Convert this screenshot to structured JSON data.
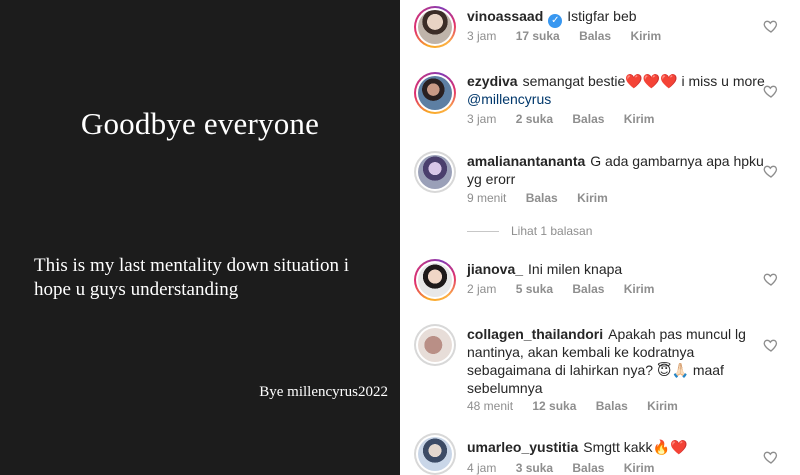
{
  "story": {
    "headline": "Goodbye everyone",
    "message": "This is my last mentality down situation i hope u guys understanding",
    "signoff": "Bye millencyrus2022"
  },
  "actions": {
    "reply": "Balas",
    "send": "Kirim"
  },
  "view_replies": "Lihat 1 balasan",
  "colors": {
    "story_bg": "#1c1c1c",
    "username": "#262626",
    "meta": "#8e8e8e",
    "mention": "#00376b",
    "verified": "#3897f0"
  },
  "comments": [
    {
      "username": "vinoassaad",
      "verified": true,
      "text": "Istigfar beb",
      "time": "3 jam",
      "likes": "17 suka",
      "reply": "Balas",
      "send": "Kirim",
      "avatar": "profile-photo"
    },
    {
      "username": "ezydiva",
      "verified": false,
      "text": "semangat bestie",
      "emoji": "❤️❤️❤️",
      "text2": " i miss u more ",
      "mention": "@millencyrus",
      "time": "3 jam",
      "likes": "2 suka",
      "reply": "Balas",
      "send": "Kirim",
      "avatar": "profile-photo"
    },
    {
      "username": "amalianantananta",
      "verified": false,
      "text": "G ada gambarnya apa hpku yg erorr",
      "time": "9 menit",
      "reply": "Balas",
      "send": "Kirim",
      "avatar": "profile-photo"
    },
    {
      "username": "jianova_",
      "verified": false,
      "text": "Ini milen knapa",
      "time": "2 jam",
      "likes": "5 suka",
      "reply": "Balas",
      "send": "Kirim",
      "avatar": "profile-photo"
    },
    {
      "username": "collagen_thailandori",
      "verified": false,
      "text": "Apakah pas muncul lg nantinya, akan kembali ke kodratnya sebagaimana di lahirkan nya?",
      "emoji": " 😇🙏🏻",
      "text2": " maaf sebelumnya",
      "time": "48 menit",
      "likes": "12 suka",
      "reply": "Balas",
      "send": "Kirim",
      "avatar": "profile-photo"
    },
    {
      "username": "umarleo_yustitia",
      "verified": false,
      "text": "Smgtt kakk",
      "emoji": "🔥❤️",
      "time": "4 jam",
      "likes": "3 suka",
      "reply": "Balas",
      "send": "Kirim",
      "avatar": "profile-photo"
    }
  ]
}
